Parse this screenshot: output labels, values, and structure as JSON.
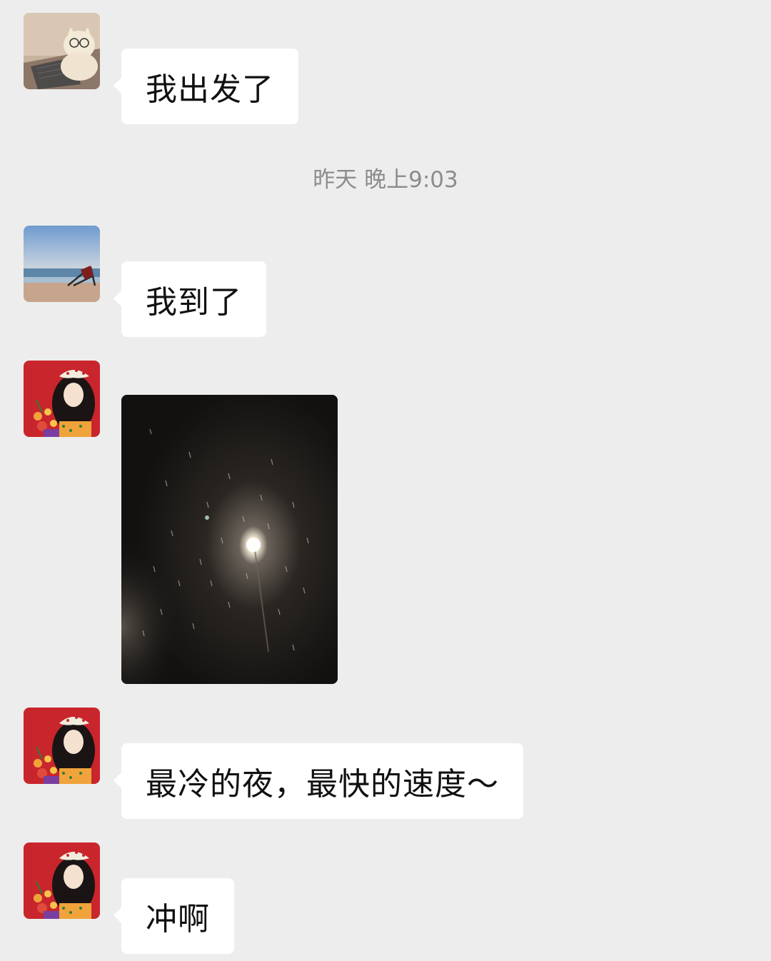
{
  "chat": {
    "messages": [
      {
        "sender": "cat-laptop",
        "text": "我出发了"
      },
      {
        "sender": "beach",
        "text": "我到了"
      },
      {
        "sender": "girl-illustration",
        "type": "image",
        "image_alt": "night snow under a streetlight"
      },
      {
        "sender": "girl-illustration",
        "text": "最冷的夜，最快的速度～"
      },
      {
        "sender": "girl-illustration",
        "text": "冲啊"
      }
    ],
    "timestamp": "昨天 晚上9:03"
  },
  "colors": {
    "background": "#ededed",
    "bubble": "#ffffff",
    "timestamp_text": "#8c8c8c"
  },
  "icons": {
    "avatar_1": "cat-with-glasses-avatar",
    "avatar_2": "beach-chair-avatar",
    "avatar_3": "girl-with-flowers-avatar"
  }
}
